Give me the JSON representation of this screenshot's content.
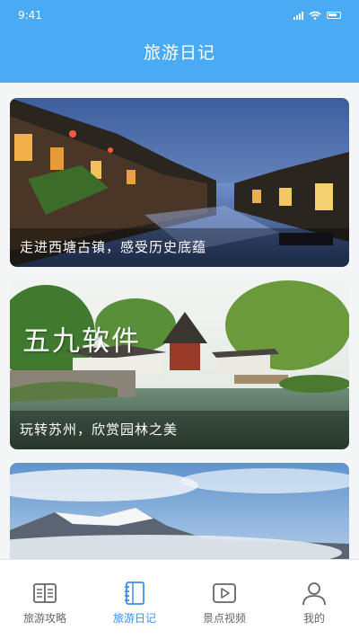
{
  "status": {
    "time": "9:41"
  },
  "header": {
    "title": "旅游日记"
  },
  "cards": [
    {
      "caption": "走进西塘古镇，感受历史底蕴"
    },
    {
      "caption": "玩转苏州，欣赏园林之美",
      "watermark": "五九软件"
    },
    {
      "caption": ""
    }
  ],
  "tabs": [
    {
      "label": "旅游攻略",
      "icon": "book-open-icon"
    },
    {
      "label": "旅游日记",
      "icon": "notebook-icon",
      "active": true
    },
    {
      "label": "景点视频",
      "icon": "video-play-icon"
    },
    {
      "label": "我的",
      "icon": "person-icon"
    }
  ],
  "colors": {
    "primary": "#4aaaf3",
    "tab_active": "#3a8ff0",
    "tab_inactive": "#666666"
  }
}
